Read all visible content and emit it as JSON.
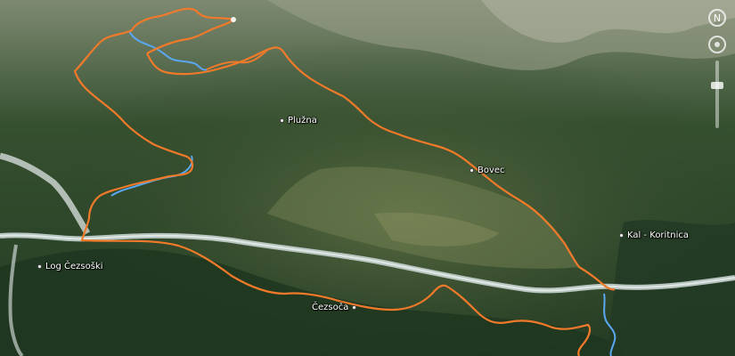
{
  "map": {
    "type": "satellite",
    "route_color": "#f07a2a",
    "stream_color": "#5aa7f2",
    "river_color": "#c7d3d0"
  },
  "places": [
    {
      "id": "pluzna",
      "name": "Plužna"
    },
    {
      "id": "bovec",
      "name": "Bovec"
    },
    {
      "id": "kal-koritnica",
      "name": "Kal - Koritnica"
    },
    {
      "id": "log-cezsoski",
      "name": "Log Čezsoški"
    },
    {
      "id": "cezsoca",
      "name": "Čezsoča"
    }
  ],
  "navigation": {
    "compass_label": "N",
    "icons": [
      "compass-icon",
      "look-icon",
      "zoom-slider-icon"
    ]
  }
}
